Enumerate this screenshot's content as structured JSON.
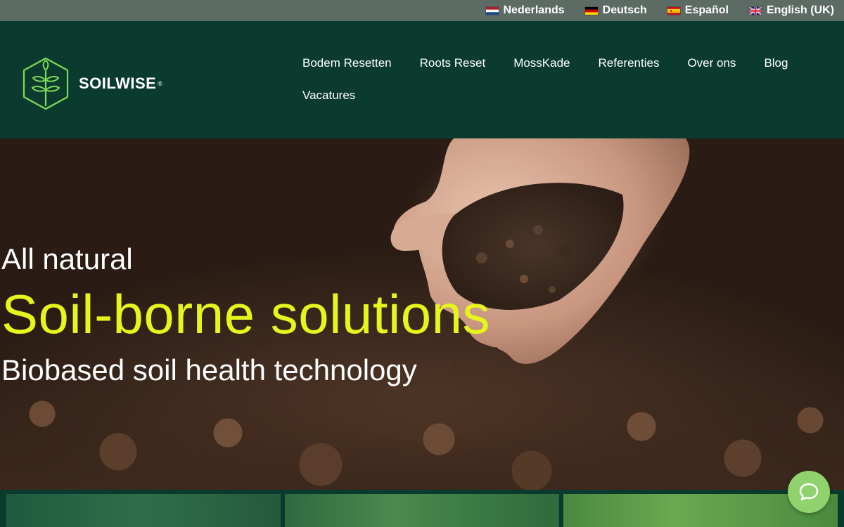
{
  "languages": [
    {
      "label": "Nederlands",
      "flag": "nl-flag-icon"
    },
    {
      "label": "Deutsch",
      "flag": "de-flag-icon"
    },
    {
      "label": "Español",
      "flag": "es-flag-icon"
    },
    {
      "label": "English (UK)",
      "flag": "uk-flag-icon"
    }
  ],
  "brand": {
    "name": "SOILWISE",
    "registered": "®",
    "logo_icon": "leaf-hexagon-icon"
  },
  "nav": {
    "items": [
      {
        "label": "Bodem Resetten"
      },
      {
        "label": "Roots Reset"
      },
      {
        "label": "MossKade"
      },
      {
        "label": "Referenties"
      },
      {
        "label": "Over ons"
      },
      {
        "label": "Blog"
      },
      {
        "label": "Vacatures"
      }
    ]
  },
  "hero": {
    "kicker": "All natural",
    "title": "Soil-borne solutions",
    "subtitle": "Biobased soil health technology"
  },
  "chat": {
    "icon": "chat-bubble-icon"
  },
  "colors": {
    "header_bg": "#0b3b2e",
    "lang_bar_bg": "#5c6b63",
    "accent_yellow": "#e6f51c",
    "chat_green": "#8fd26e",
    "logo_green": "#7ed957"
  }
}
